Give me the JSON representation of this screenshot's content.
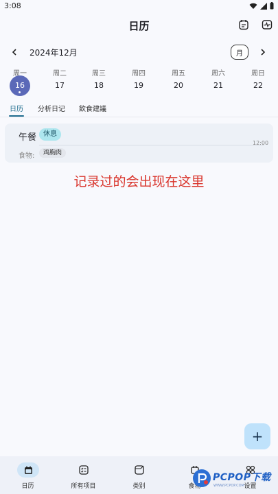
{
  "status_bar": {
    "time": "3:08"
  },
  "header": {
    "title": "日历",
    "left_icon": "calendar-note-icon",
    "right_icon": "activity-icon"
  },
  "month_nav": {
    "month": "2024年12月",
    "view_toggle": "月"
  },
  "week": {
    "days": [
      {
        "name": "周一",
        "date": "16",
        "selected": true
      },
      {
        "name": "周二",
        "date": "17"
      },
      {
        "name": "周三",
        "date": "18"
      },
      {
        "name": "周四",
        "date": "19"
      },
      {
        "name": "周五",
        "date": "20"
      },
      {
        "name": "周六",
        "date": "21"
      },
      {
        "name": "周日",
        "date": "22"
      }
    ]
  },
  "tabs": [
    {
      "label": "日历",
      "active": true
    },
    {
      "label": "分析日记"
    },
    {
      "label": "飲食建議"
    }
  ],
  "entry": {
    "meal": "午餐",
    "tag": "休息",
    "time": "12:00",
    "food_label": "食物:",
    "food": "鸡胸肉"
  },
  "annotation": "记录过的会出现在这里",
  "fab": {
    "label": "+"
  },
  "bottom_nav": [
    {
      "label": "日历",
      "icon": "calendar-icon",
      "active": true
    },
    {
      "label": "所有项目",
      "icon": "checklist-icon"
    },
    {
      "label": "类别",
      "icon": "folder-icon"
    },
    {
      "label": "食物",
      "icon": "food-icon"
    },
    {
      "label": "设置",
      "icon": "grid-icon"
    }
  ],
  "watermark": {
    "text": "PCPOP下载",
    "sub": "WWW.PCPOP.COM"
  },
  "colors": {
    "accent": "#5b69b8",
    "tab_active": "#1f6d8e",
    "annotation": "#d9342b",
    "fab": "#bfe2fb"
  }
}
